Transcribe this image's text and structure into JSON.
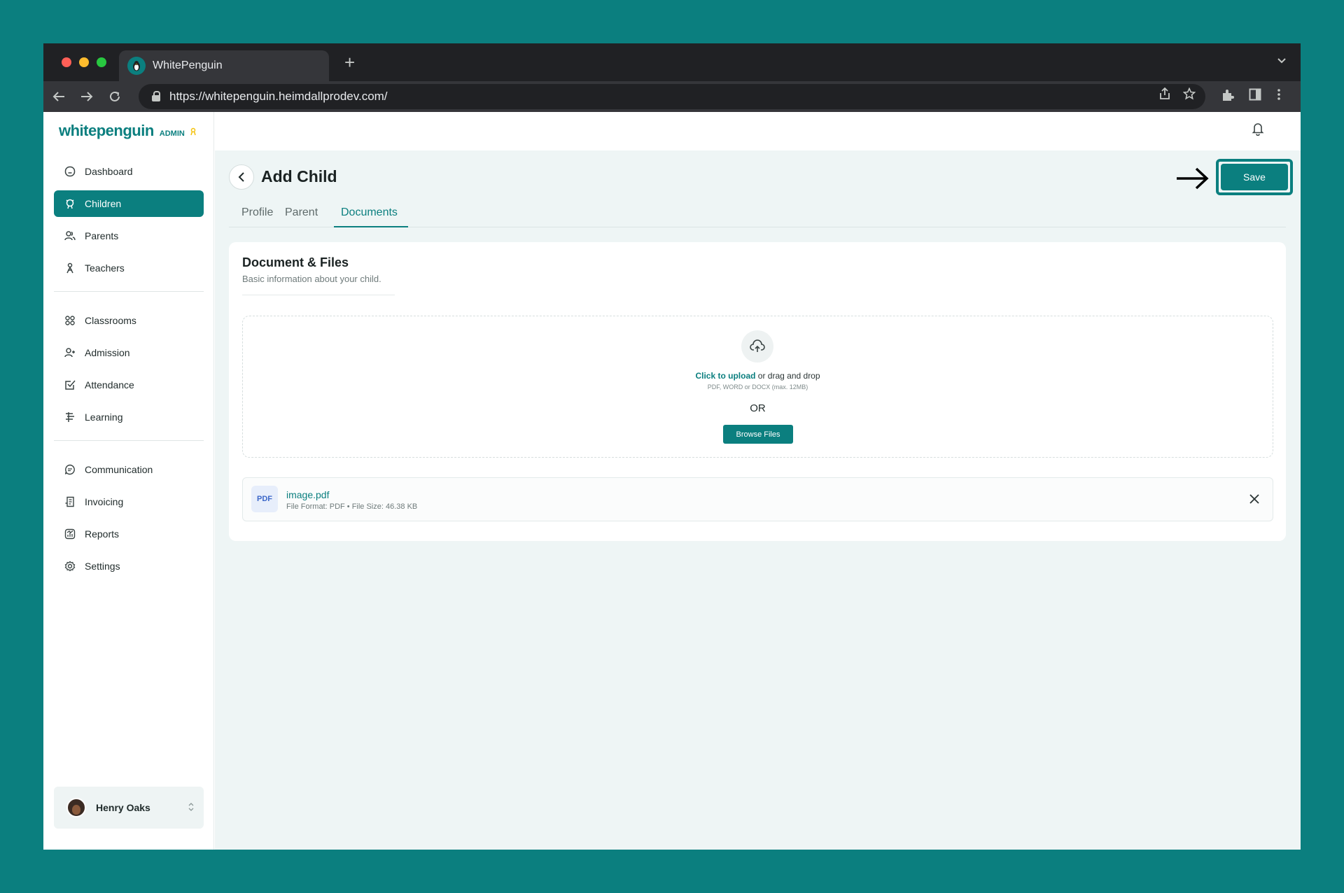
{
  "browser": {
    "tab_title": "WhitePenguin",
    "new_tab_symbol": "+",
    "url": "https://whitepenguin.heimdallprodev.com/"
  },
  "brand": {
    "logo_text": "whitepenguin",
    "admin_label": "ADMIN",
    "accent_color": "#0b7f7f",
    "background_color": "#0b7f7f"
  },
  "sidebar": {
    "group1": [
      {
        "label": "Dashboard",
        "icon": "home-icon",
        "active": false
      },
      {
        "label": "Children",
        "icon": "children-icon",
        "active": true
      },
      {
        "label": "Parents",
        "icon": "parents-icon",
        "active": false
      },
      {
        "label": "Teachers",
        "icon": "teachers-icon",
        "active": false
      }
    ],
    "group2": [
      {
        "label": "Classrooms",
        "icon": "grid-icon"
      },
      {
        "label": "Admission",
        "icon": "user-plus-icon"
      },
      {
        "label": "Attendance",
        "icon": "check-square-icon"
      },
      {
        "label": "Learning",
        "icon": "book-icon"
      }
    ],
    "group3": [
      {
        "label": "Communication",
        "icon": "chat-icon"
      },
      {
        "label": "Invoicing",
        "icon": "invoice-icon"
      },
      {
        "label": "Reports",
        "icon": "chart-icon"
      },
      {
        "label": "Settings",
        "icon": "gear-icon"
      }
    ],
    "user": {
      "name": "Henry Oaks"
    }
  },
  "page": {
    "title": "Add Child",
    "save_label": "Save",
    "tabs": [
      {
        "label": "Profile",
        "active": false
      },
      {
        "label": "Parent",
        "active": false
      },
      {
        "label": "Documents",
        "active": true
      }
    ]
  },
  "documents": {
    "title": "Document & Files",
    "subtitle": "Basic information about your child.",
    "upload_link": "Click to upload",
    "upload_rest": " or drag and drop",
    "upload_hint": "PDF, WORD or DOCX (max. 12MB)",
    "or_label": "OR",
    "browse_label": "Browse Files",
    "file": {
      "type_badge": "PDF",
      "name": "image.pdf",
      "meta": "File Format: PDF • File Size: 46.38 KB"
    }
  }
}
